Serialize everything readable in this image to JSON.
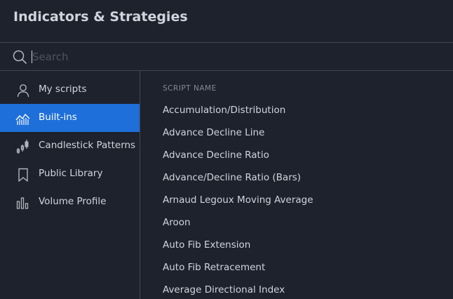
{
  "dialog": {
    "title": "Indicators & Strategies"
  },
  "search": {
    "placeholder": "Search",
    "value": "",
    "icon": "search-icon"
  },
  "sidebar": {
    "items": [
      {
        "label": "My scripts",
        "icon": "user-icon",
        "active": false
      },
      {
        "label": "Built-ins",
        "icon": "chart-area-icon",
        "active": true
      },
      {
        "label": "Candlestick Patterns",
        "icon": "candlestick-icon",
        "active": false
      },
      {
        "label": "Public Library",
        "icon": "bookmark-icon",
        "active": false
      },
      {
        "label": "Volume Profile",
        "icon": "volume-bars-icon",
        "active": false
      }
    ]
  },
  "list": {
    "column_header": "SCRIPT NAME",
    "scripts": [
      "Accumulation/Distribution",
      "Advance Decline Line",
      "Advance Decline Ratio",
      "Advance/Decline Ratio (Bars)",
      "Arnaud Legoux Moving Average",
      "Aroon",
      "Auto Fib Extension",
      "Auto Fib Retracement",
      "Average Directional Index"
    ]
  },
  "colors": {
    "background": "#1e222d",
    "divider": "#434651",
    "active_bg": "#1e6fd9",
    "text": "#d1d4dc",
    "muted": "#868993"
  }
}
